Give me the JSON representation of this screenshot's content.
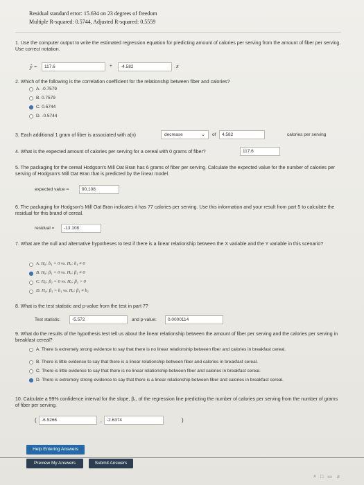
{
  "summary": {
    "line1": "Residual standard error: 15.634 on 23 degrees of freedom",
    "line2": "Multiple R-squared: 0.5744, Adjusted R-squared: 0.5559"
  },
  "q1": {
    "text": "1. Use the computer output to write the estimated regression equation for predicting amount of calories per serving from the amount of fiber per serving. Use correct notation.",
    "yhat": "ŷ =",
    "intercept": "117.6",
    "plus": "+",
    "slope": "-4.582",
    "xvar": "x"
  },
  "q2": {
    "text": "2. Which of the following is the correlation coefficient for the relationship between fiber and calories?",
    "options": [
      "A. -0.7579",
      "B. 0.7579",
      "C. 0.5744",
      "D. -0.5744"
    ],
    "selected": "C"
  },
  "q3": {
    "text": "3. Each additional 1 gram of fiber is associated with a(n)",
    "select_value": "decrease",
    "of": "of",
    "value": "4.582",
    "suffix": "calories per serving"
  },
  "q4": {
    "text": "4. What is the expected amount of calories per serving for a cereal with 0 grams of fiber?",
    "value": "117.6"
  },
  "q5": {
    "text": "5. The packaging for the cereal Hodgson's Mill Oat Bran has 6 grams of fiber per serving. Calculate the expected value for the number of calories per serving of Hodgson's Mill Oat Bran that is predicted by the linear model.",
    "label": "expected value =",
    "value": "90.108"
  },
  "q6": {
    "text": "6. The packaging for Hodgson's Mill Oat Bran indicates it has 77 calories per serving. Use this information and your result from part 5 to calculate the residual for this brand of cereal.",
    "label": "residual =",
    "value": "-13.108"
  },
  "q7": {
    "text": "7. What are the null and alternative hypotheses to test if there is a linear relationship between the X variable and the Y variable in this scenario?",
    "options": [
      "A. H₀: b₁ = 0 vs. Hₐ: b₁ ≠ 0",
      "B. H₀: β₁ = 0 vs. Hₐ: β₁ ≠ 0",
      "C. H₀: β₁ = 0 vs. Hₐ: β₁ > 0",
      "D. H₀: β₁ = b₁ vs. Hₐ: β₁ ≠ b₁"
    ],
    "selected": "B"
  },
  "q8": {
    "text": "8. What is the test statistic and p-value from the test in part 7?",
    "stat_label": "Test statistic:",
    "stat_value": "-5.572",
    "p_label": "and p-value:",
    "p_value": "0.0000114"
  },
  "q9": {
    "text": "9. What do the results of the hypothesis test tell us about the linear relationship between the amount of fiber per serving and the calories per serving in breakfast cereal?",
    "options": [
      "A. There is extremely strong evidence to say that there is no linear relationship between fiber and calories in breakfast cereal.",
      "B. There is little evidence to say that there is a linear relationship between fiber and calories in breakfast cereal.",
      "C. There is little evidence to say that there is no linear relationship between fiber and calories in breakfast cereal.",
      "D. There is extremely strong evidence to say that there is a linear relationship between fiber and calories in breakfast cereal."
    ],
    "selected": "D"
  },
  "q10": {
    "text": "10. Calculate a 99% confidence interval for the slope, β₁, of the regression line predicting the number of calories per serving from the number of grams of fiber per serving.",
    "open": "(",
    "lower": "-6.5266",
    "comma": ",",
    "upper": "-2.6374",
    "close": ")"
  },
  "buttons": {
    "help": "Help Entering Answers",
    "preview": "Preview My Answers",
    "submit": "Submit Answers"
  },
  "colors": {
    "accent": "#256aa6",
    "selected_radio": "#3a76c4"
  }
}
